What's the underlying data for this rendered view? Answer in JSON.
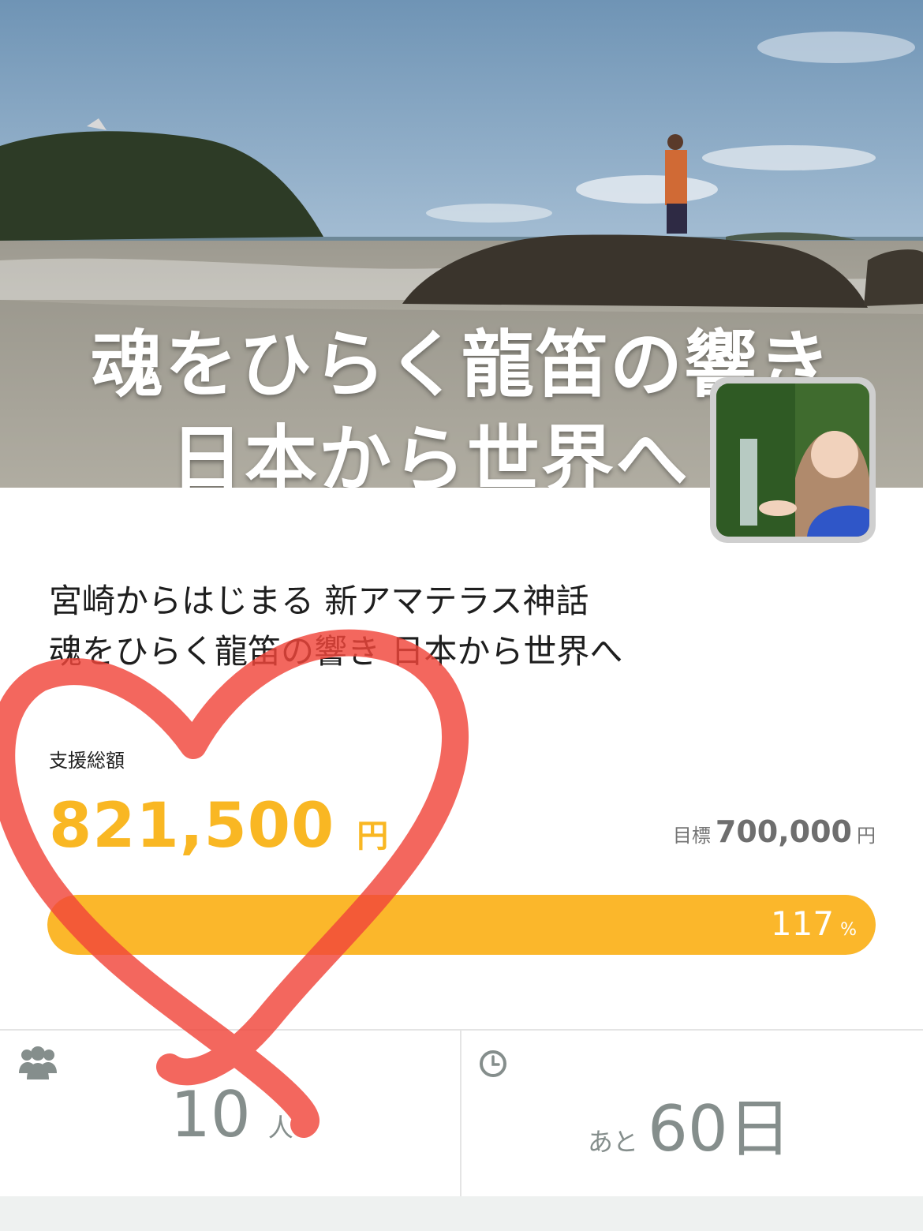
{
  "hero": {
    "title_line1": "魂をひらく龍笛の響き",
    "title_line2": "日本から世界へ"
  },
  "project": {
    "title_line1": "宮崎からはじまる 新アマテラス神話",
    "title_line2": "魂をひらく龍笛の響き 日本から世界へ"
  },
  "funding": {
    "label": "支援総額",
    "amount": "821,500",
    "amount_unit": "円",
    "goal_label": "目標",
    "goal_amount": "700,000",
    "goal_unit": "円",
    "percent": "117",
    "percent_unit": "%",
    "progress_fraction": 1.0
  },
  "stats": {
    "backers": "10",
    "backers_unit": "人",
    "days_prefix": "あと",
    "days_left": "60日",
    "backers_icon": "users-icon",
    "time_icon": "clock-icon"
  },
  "colors": {
    "accent": "#f9b723",
    "progress": "#fbb72b",
    "heart_overlay": "#f0453a",
    "stat_text": "#858e8c"
  }
}
